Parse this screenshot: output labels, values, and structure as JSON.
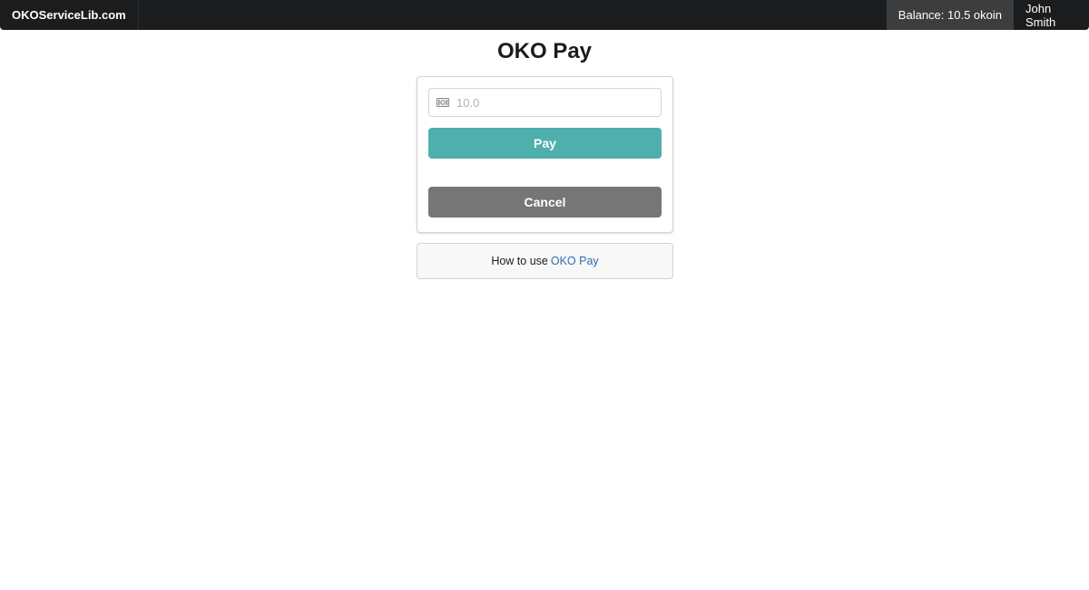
{
  "navbar": {
    "brand": "OKOServiceLib.com",
    "balance": "Balance: 10.5 okoin",
    "user": "John Smith"
  },
  "page": {
    "title": "OKO Pay"
  },
  "payment_form": {
    "amount_placeholder": "10.0",
    "amount_icon": "money-icon",
    "pay_label": "Pay",
    "cancel_label": "Cancel"
  },
  "help": {
    "text": "How to use",
    "link_text": "OKO Pay"
  },
  "colors": {
    "navbar": "#1b1c1d",
    "pay_button": "#4fafac",
    "cancel_button": "#767676",
    "link": "#2e6cb0"
  }
}
